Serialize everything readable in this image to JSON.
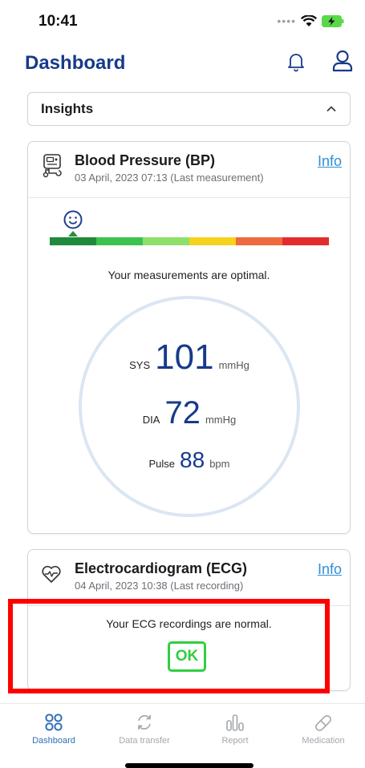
{
  "status_bar": {
    "time": "10:41"
  },
  "header": {
    "title": "Dashboard"
  },
  "insights": {
    "label": "Insights"
  },
  "bp_card": {
    "title": "Blood Pressure (BP)",
    "subtitle": "03 April, 2023 07:13 (Last measurement)",
    "info_label": "Info",
    "message": "Your measurements are optimal.",
    "scale_colors": [
      "#1f8a3b",
      "#3cc24f",
      "#8ee06b",
      "#f6d21c",
      "#ee6a3f",
      "#e32b2b"
    ],
    "scale_level_index": 0,
    "sys": {
      "label": "SYS",
      "value": "101",
      "unit": "mmHg"
    },
    "dia": {
      "label": "DIA",
      "value": "72",
      "unit": "mmHg"
    },
    "pulse": {
      "label": "Pulse",
      "value": "88",
      "unit": "bpm"
    }
  },
  "ecg_card": {
    "title": "Electrocardiogram (ECG)",
    "subtitle": "04 April, 2023 10:38 (Last recording)",
    "info_label": "Info",
    "message": "Your ECG recordings are normal.",
    "badge": "OK"
  },
  "tabs": [
    {
      "label": "Dashboard",
      "icon": "dashboard-icon",
      "active": true
    },
    {
      "label": "Data transfer",
      "icon": "sync-icon",
      "active": false
    },
    {
      "label": "Report",
      "icon": "report-icon",
      "active": false
    },
    {
      "label": "Medication",
      "icon": "pill-icon",
      "active": false
    }
  ],
  "colors": {
    "accent": "#173a8a",
    "link": "#2f8fd8",
    "ok": "#2fcf3f",
    "highlight": "#ff0000"
  }
}
